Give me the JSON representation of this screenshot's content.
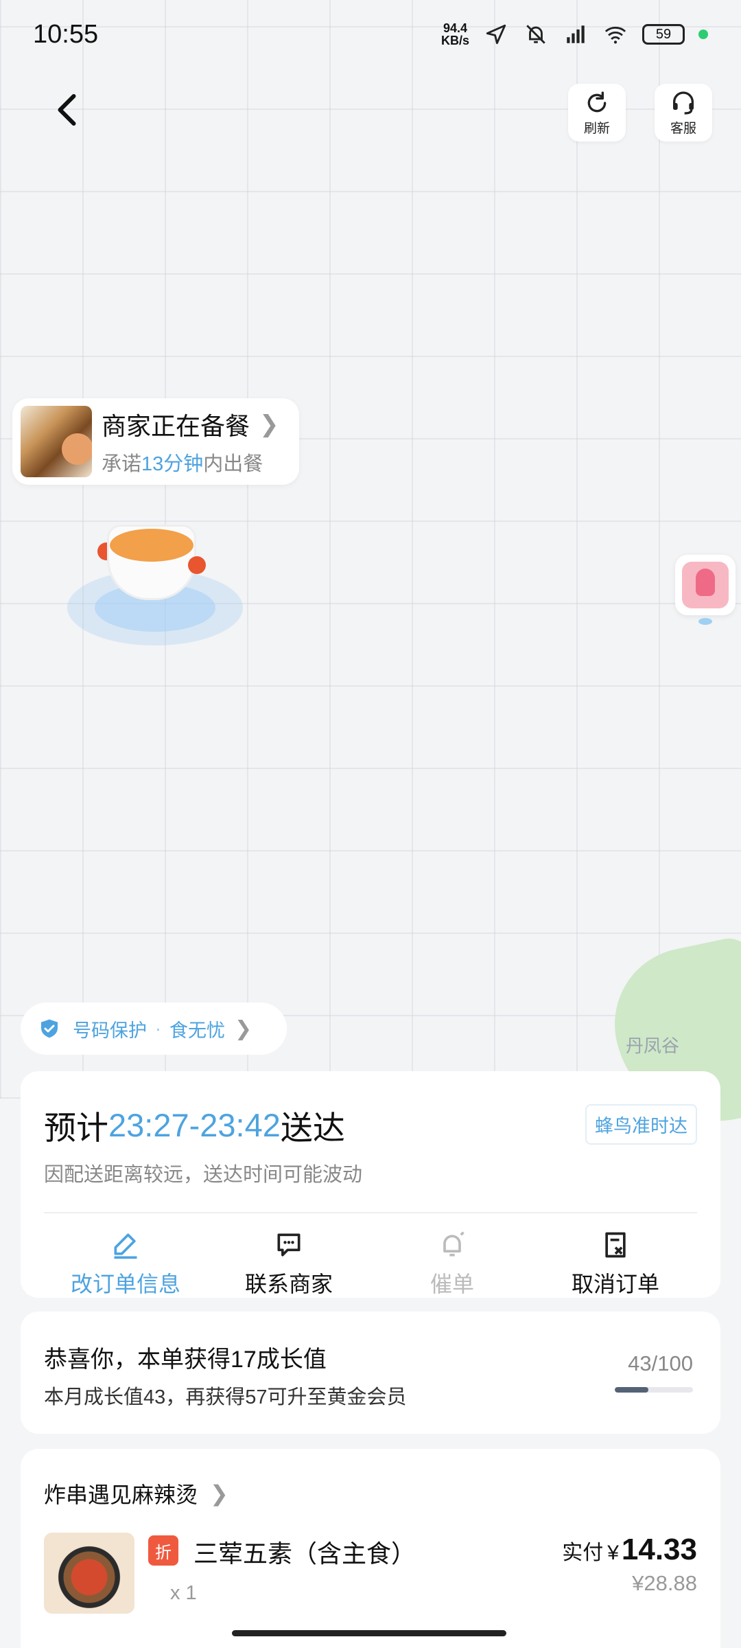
{
  "status_bar": {
    "time": "10:55",
    "net_speed": "94.4",
    "net_unit": "KB/s",
    "battery": "59"
  },
  "top_buttons": {
    "refresh_label": "刷新",
    "service_label": "客服"
  },
  "map": {
    "place_label": "丹凤谷"
  },
  "merchant_status": {
    "title": "商家正在备餐",
    "promise_prefix": "承诺",
    "promise_time": "13分钟",
    "promise_suffix": "内出餐"
  },
  "protection": {
    "item1": "号码保护",
    "separator": "·",
    "item2": "食无忧"
  },
  "delivery": {
    "eta_prefix": "预计",
    "eta_time": "23:27-23:42",
    "eta_suffix": "送达",
    "tag": "蜂鸟准时达",
    "note": "因配送距离较远，送达时间可能波动",
    "actions": [
      {
        "label": "改订单信息",
        "icon": "edit-icon"
      },
      {
        "label": "联系商家",
        "icon": "chat-icon"
      },
      {
        "label": "催单",
        "icon": "bell-icon"
      },
      {
        "label": "取消订单",
        "icon": "cancel-order-icon"
      }
    ]
  },
  "growth": {
    "title": "恭喜你，本单获得17成长值",
    "subtitle": "本月成长值43，再获得57可升至黄金会员",
    "count": "43/100",
    "progress": 0.43
  },
  "order": {
    "shop_name": "炸串遇见麻辣烫",
    "item_tag": "折",
    "item_name": "三荤五素（含主食）",
    "item_qty": "x 1",
    "paid_label": "实付",
    "currency": "¥",
    "paid_amount": "14.33",
    "original_price": "¥28.88"
  },
  "colors": {
    "accent": "#4da3e0",
    "discount_tag": "#ef5a3f",
    "status_dot": "#2ecc71"
  }
}
